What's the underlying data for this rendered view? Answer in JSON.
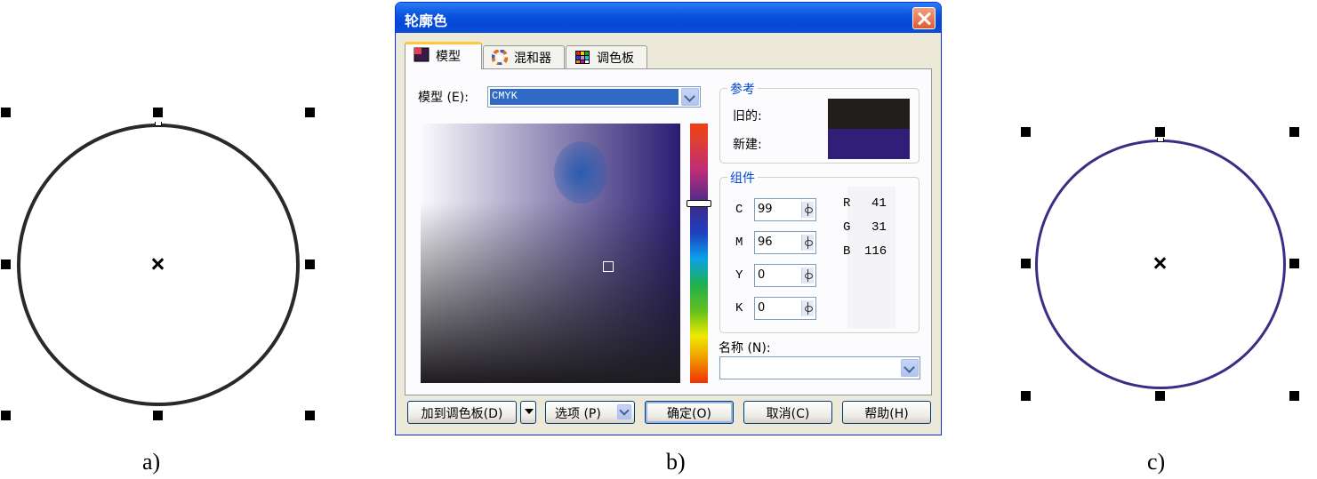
{
  "panels": {
    "a": {
      "label": "a)",
      "outline_color": "#2b2926"
    },
    "b": {
      "label": "b)"
    },
    "c": {
      "label": "c)",
      "outline_color": "#3d2c83"
    }
  },
  "dialog": {
    "title": "轮廓色",
    "close_icon": "close-icon",
    "tabs": [
      {
        "label": "模型",
        "icon": "model-icon",
        "active": true
      },
      {
        "label": "混和器",
        "icon": "mixer-icon",
        "active": false
      },
      {
        "label": "调色板",
        "icon": "palette-icon",
        "active": false
      }
    ],
    "model": {
      "label": "模型 (E):",
      "value": "CMYK"
    },
    "reference": {
      "title": "参考",
      "old_label": "旧的:",
      "new_label": "新建:",
      "old_color": "#221e1b",
      "new_color": "#2f1f78"
    },
    "components": {
      "title": "组件",
      "cmyk": [
        {
          "name": "C",
          "value": "99"
        },
        {
          "name": "M",
          "value": "96"
        },
        {
          "name": "Y",
          "value": "0"
        },
        {
          "name": "K",
          "value": "0"
        }
      ],
      "rgb": [
        {
          "name": "R",
          "value": "41"
        },
        {
          "name": "G",
          "value": "31"
        },
        {
          "name": "B",
          "value": "116"
        }
      ]
    },
    "name_field": {
      "label": "名称 (N):",
      "value": ""
    },
    "buttons": {
      "add_to_palette": "加到调色板(D)",
      "options": "选项 (P)",
      "ok": "确定(O)",
      "cancel": "取消(C)",
      "help": "帮助(H)"
    }
  }
}
